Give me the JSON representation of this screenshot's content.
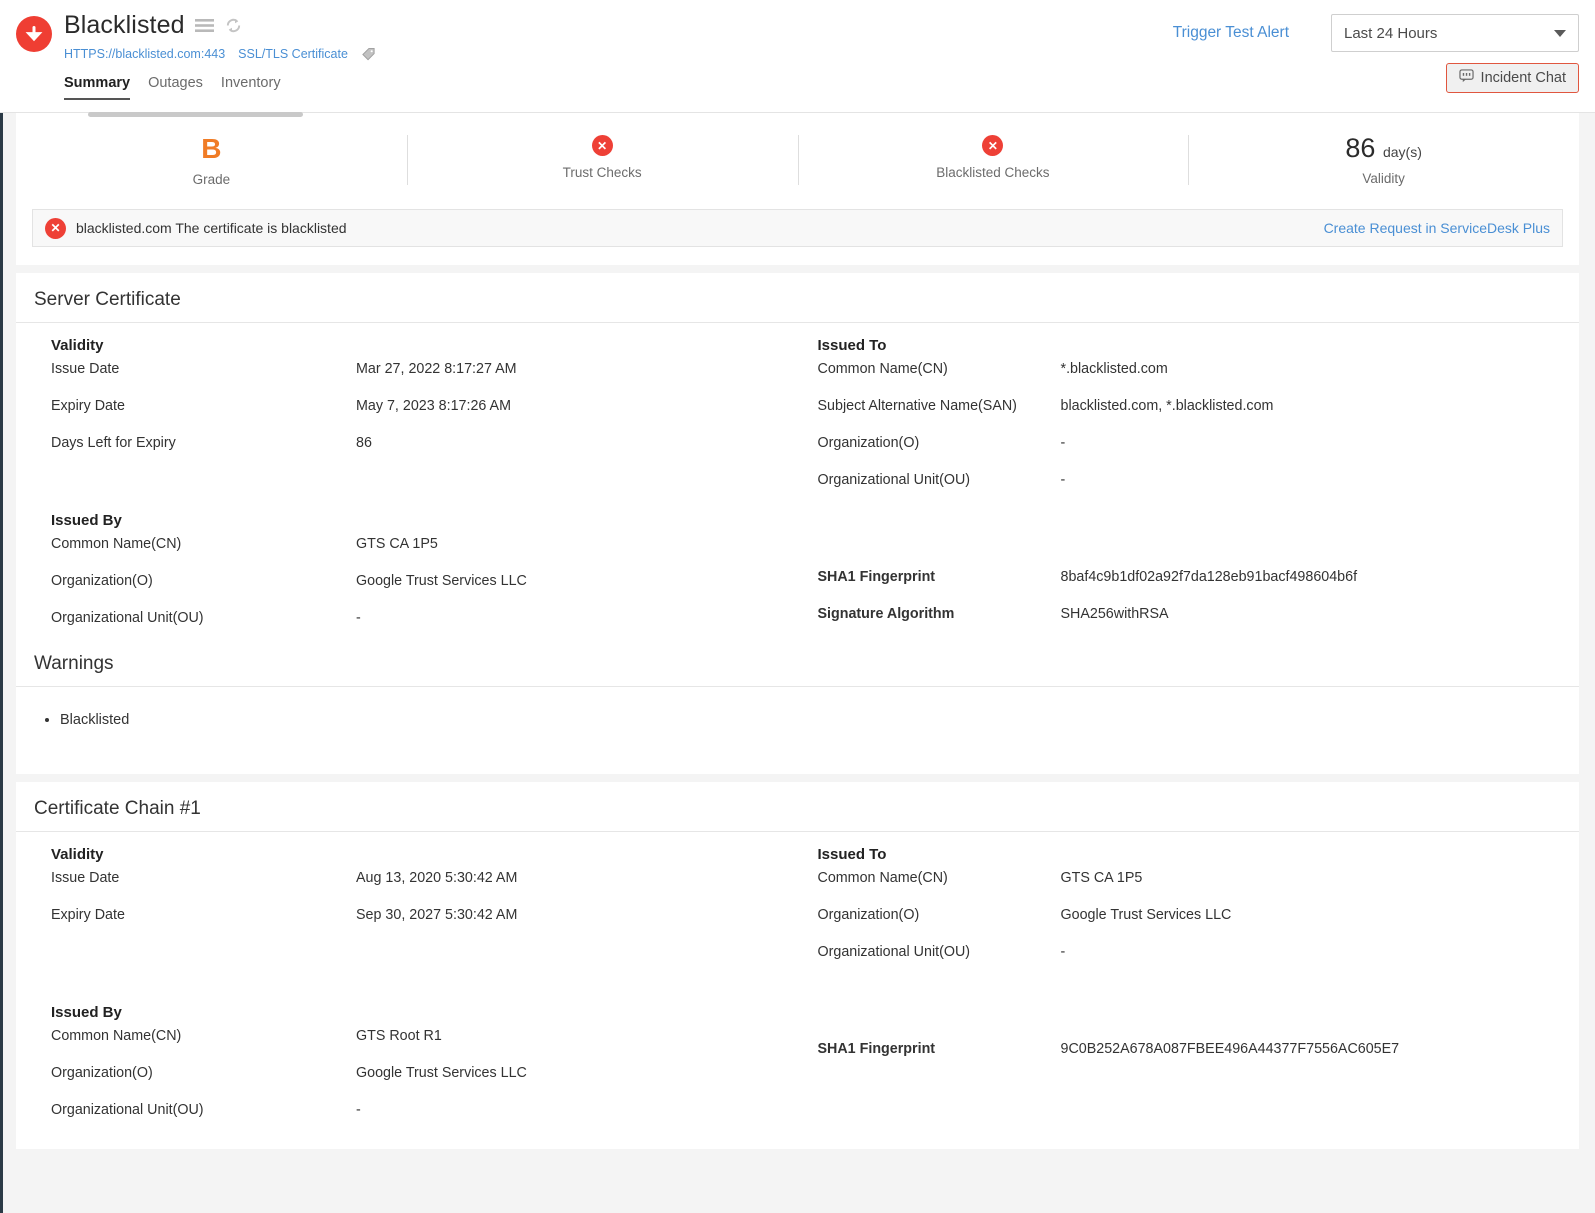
{
  "header": {
    "title": "Blacklisted",
    "status_icon": "down-arrow-circle-icon",
    "menu_icon": "hamburger-menu-icon",
    "refresh_icon": "refresh-icon",
    "url": "HTTPS://blacklisted.com:443",
    "monitor_type": "SSL/TLS Certificate",
    "tag_icon": "tag-icon",
    "tabs": [
      {
        "label": "Summary",
        "active": true
      },
      {
        "label": "Outages",
        "active": false
      },
      {
        "label": "Inventory",
        "active": false
      }
    ],
    "trigger_test_alert": "Trigger Test Alert",
    "period": {
      "value": "Last 24 Hours",
      "caret_icon": "chevron-down-icon"
    },
    "incident_chat": {
      "label": "Incident Chat",
      "icon": "chat-bubble-icon"
    }
  },
  "stats": [
    {
      "value": "B",
      "label": "Grade",
      "kind": "grade"
    },
    {
      "value": "",
      "label": "Trust Checks",
      "kind": "fail",
      "icon": "error-x-icon"
    },
    {
      "value": "",
      "label": "Blacklisted Checks",
      "kind": "fail",
      "icon": "error-x-icon"
    },
    {
      "value": "86",
      "unit": "day(s)",
      "label": "Validity",
      "kind": "number"
    }
  ],
  "alert": {
    "icon": "error-x-icon",
    "message": "blacklisted.com The certificate is blacklisted",
    "action": "Create Request in ServiceDesk Plus"
  },
  "server_certificate": {
    "title": "Server Certificate",
    "validity": {
      "heading": "Validity",
      "rows": [
        {
          "key": "Issue Date",
          "value": "Mar 27, 2022 8:17:27 AM"
        },
        {
          "key": "Expiry Date",
          "value": "May 7, 2023 8:17:26 AM"
        },
        {
          "key": "Days Left for Expiry",
          "value": "86"
        }
      ]
    },
    "issued_by": {
      "heading": "Issued By",
      "rows": [
        {
          "key": "Common Name(CN)",
          "value": "GTS CA 1P5"
        },
        {
          "key": "Organization(O)",
          "value": "Google Trust Services LLC"
        },
        {
          "key": "Organizational Unit(OU)",
          "value": "-"
        }
      ]
    },
    "issued_to": {
      "heading": "Issued To",
      "rows": [
        {
          "key": "Common Name(CN)",
          "value": "*.blacklisted.com"
        },
        {
          "key": "Subject Alternative Name(SAN)",
          "value": "blacklisted.com, *.blacklisted.com"
        },
        {
          "key": "Organization(O)",
          "value": "-"
        },
        {
          "key": "Organizational Unit(OU)",
          "value": "-"
        }
      ]
    },
    "fingerprint": {
      "rows": [
        {
          "key": "SHA1 Fingerprint",
          "value": "8baf4c9b1df02a92f7da128eb91bacf498604b6f"
        },
        {
          "key": "Signature Algorithm",
          "value": "SHA256withRSA"
        }
      ]
    },
    "warnings": {
      "title": "Warnings",
      "items": [
        "Blacklisted"
      ]
    }
  },
  "certificate_chain_1": {
    "title": "Certificate Chain #1",
    "validity": {
      "heading": "Validity",
      "rows": [
        {
          "key": "Issue Date",
          "value": "Aug 13, 2020 5:30:42 AM"
        },
        {
          "key": "Expiry Date",
          "value": "Sep 30, 2027 5:30:42 AM"
        }
      ]
    },
    "issued_by": {
      "heading": "Issued By",
      "rows": [
        {
          "key": "Common Name(CN)",
          "value": "GTS Root R1"
        },
        {
          "key": "Organization(O)",
          "value": "Google Trust Services LLC"
        },
        {
          "key": "Organizational Unit(OU)",
          "value": "-"
        }
      ]
    },
    "issued_to": {
      "heading": "Issued To",
      "rows": [
        {
          "key": "Common Name(CN)",
          "value": "GTS CA 1P5"
        },
        {
          "key": "Organization(O)",
          "value": "Google Trust Services LLC"
        },
        {
          "key": "Organizational Unit(OU)",
          "value": "-"
        }
      ]
    },
    "fingerprint": {
      "rows": [
        {
          "key": "SHA1 Fingerprint",
          "value": "9C0B252A678A087FBEE496A44377F7556AC605E7"
        }
      ]
    }
  },
  "colors": {
    "danger": "#ee4036",
    "grade": "#f07c26",
    "link": "#4a8fd4",
    "incident_border": "#e0563f"
  }
}
